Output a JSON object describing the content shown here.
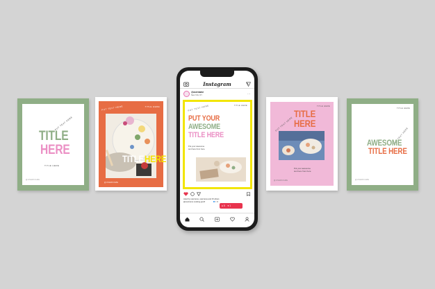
{
  "cards": {
    "green_left": {
      "arc_text": "PUT TEXT HERE",
      "title_line1": "TITLE",
      "title_line2": "HERE",
      "subtitle": "TITLE HERE",
      "handle": "@USERNAME",
      "colors": {
        "frame": "#8fae86",
        "title1": "#8fae86",
        "title2": "#eb8fc4"
      }
    },
    "orange": {
      "arc_text": "PUT TEXT HERE",
      "top_right": "TITLE HERE",
      "title_word1": "TITLE",
      "title_word2": "HERE",
      "handle": "@USERNAME",
      "colors": {
        "background": "#e76d44",
        "title1": "#ffffff",
        "title2": "#f5e200"
      }
    },
    "pink": {
      "top_right": "TITLE HERE",
      "arc_text": "PUT TEXT HERE",
      "title_line1": "TITLE",
      "title_line2": "HERE",
      "body_line1": "Put your awesome",
      "body_line2": "text here from here",
      "handle": "@USERNAME",
      "colors": {
        "background": "#f1b9d8",
        "title": "#e76d44"
      }
    },
    "green_right": {
      "top_right": "TITLE HERE",
      "arc_text": "PUT TEXT HERE",
      "title_line1": "AWESOME",
      "title_line2": "TITLE HERE",
      "handle": "@USERNAME",
      "colors": {
        "frame": "#8fae86",
        "title1": "#8fae86",
        "title2": "#e76d44"
      }
    }
  },
  "phone": {
    "app_name": "Instagram",
    "profile": {
      "username": "@username",
      "location": "New York, NY"
    },
    "post": {
      "arc_text": "PUT TEXT HERE",
      "top_right": "TITLE HERE",
      "title_line1": "PUT YOUR",
      "title_line2": "AWESOME",
      "title_line3": "TITLE HERE",
      "body_line1": "Put your awesome",
      "body_line2": "text here from here",
      "colors": {
        "border": "#f2e500",
        "line1": "#e76d44",
        "line2": "#8fae86",
        "line3": "#eb8fc4"
      }
    },
    "caption": {
      "liked_by": "Liked by username, username and 15 others",
      "comment": "@username Looking good!"
    },
    "notification_badge": {
      "comments": "5",
      "likes": "1"
    },
    "icons": [
      "camera-icon",
      "send-icon",
      "heart-icon",
      "comment-icon",
      "share-icon",
      "bookmark-icon",
      "home-icon",
      "search-icon",
      "add-icon",
      "activity-icon",
      "profile-icon"
    ]
  }
}
